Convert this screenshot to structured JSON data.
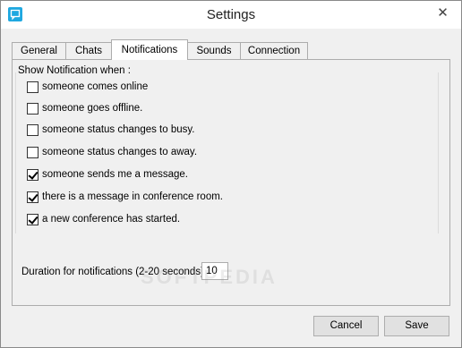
{
  "window": {
    "title": "Settings",
    "close_glyph": "✕"
  },
  "tabs": [
    {
      "label": "General"
    },
    {
      "label": "Chats"
    },
    {
      "label": "Notifications",
      "active": true
    },
    {
      "label": "Sounds"
    },
    {
      "label": "Connection"
    }
  ],
  "notifications": {
    "group_label": "Show Notification when :",
    "options": [
      {
        "label": "someone comes online",
        "checked": false
      },
      {
        "label": "someone goes offline.",
        "checked": false
      },
      {
        "label": "someone status changes to busy.",
        "checked": false
      },
      {
        "label": "someone status changes to away.",
        "checked": false
      },
      {
        "label": "someone sends me a message.",
        "checked": true
      },
      {
        "label": "there is a message in conference room.",
        "checked": true
      },
      {
        "label": "a new conference has started.",
        "checked": true
      }
    ],
    "duration_label": "Duration for notifications (2-20 seconds)",
    "duration_value": "10"
  },
  "buttons": {
    "cancel": "Cancel",
    "save": "Save"
  },
  "watermark": "SOFTPEDIA",
  "colors": {
    "accent": "#1fa8e0"
  }
}
